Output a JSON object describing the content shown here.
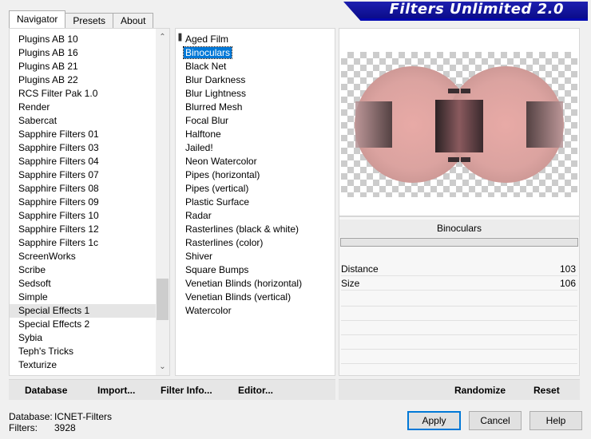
{
  "tabs": [
    "Navigator",
    "Presets",
    "About"
  ],
  "banner_title": "Filters Unlimited 2.0",
  "categories": [
    "Plugins AB 10",
    "Plugins AB 16",
    "Plugins AB 21",
    "Plugins AB 22",
    "RCS Filter Pak 1.0",
    "Render",
    "Sabercat",
    "Sapphire Filters 01",
    "Sapphire Filters 03",
    "Sapphire Filters 04",
    "Sapphire Filters 07",
    "Sapphire Filters 08",
    "Sapphire Filters 09",
    "Sapphire Filters 10",
    "Sapphire Filters 12",
    "Sapphire Filters 1c",
    "ScreenWorks",
    "Scribe",
    "Sedsoft",
    "Simple",
    "Special Effects 1",
    "Special Effects 2",
    "Sybia",
    "Teph's Tricks",
    "Texturize"
  ],
  "selected_category": "Special Effects 1",
  "filters": [
    "Aged Film",
    "Binoculars",
    "Black Net",
    "Blur Darkness",
    "Blur Lightness",
    "Blurred Mesh",
    "Focal Blur",
    "Halftone",
    "Jailed!",
    "Neon Watercolor",
    "Pipes (horizontal)",
    "Pipes (vertical)",
    "Plastic Surface",
    "Radar",
    "Rasterlines (black & white)",
    "Rasterlines (color)",
    "Shiver",
    "Square Bumps",
    "Venetian Blinds (horizontal)",
    "Venetian Blinds (vertical)",
    "Watercolor"
  ],
  "selected_filter": "Binoculars",
  "params": {
    "title": "Binoculars",
    "rows": [
      {
        "label": "Distance",
        "value": "103"
      },
      {
        "label": "Size",
        "value": "106"
      }
    ]
  },
  "left_buttons": {
    "database": "Database",
    "import": "Import...",
    "filter_info": "Filter Info...",
    "editor": "Editor..."
  },
  "right_buttons": {
    "randomize": "Randomize",
    "reset": "Reset"
  },
  "status": {
    "database_label": "Database:",
    "database_value": "ICNET-Filters",
    "filters_label": "Filters:",
    "filters_value": "3928"
  },
  "dialog_buttons": {
    "apply": "Apply",
    "cancel": "Cancel",
    "help": "Help"
  },
  "colors": {
    "selection": "#0078d7",
    "banner": "#0b0c8a",
    "preview_pink": "#e6b3b3"
  }
}
